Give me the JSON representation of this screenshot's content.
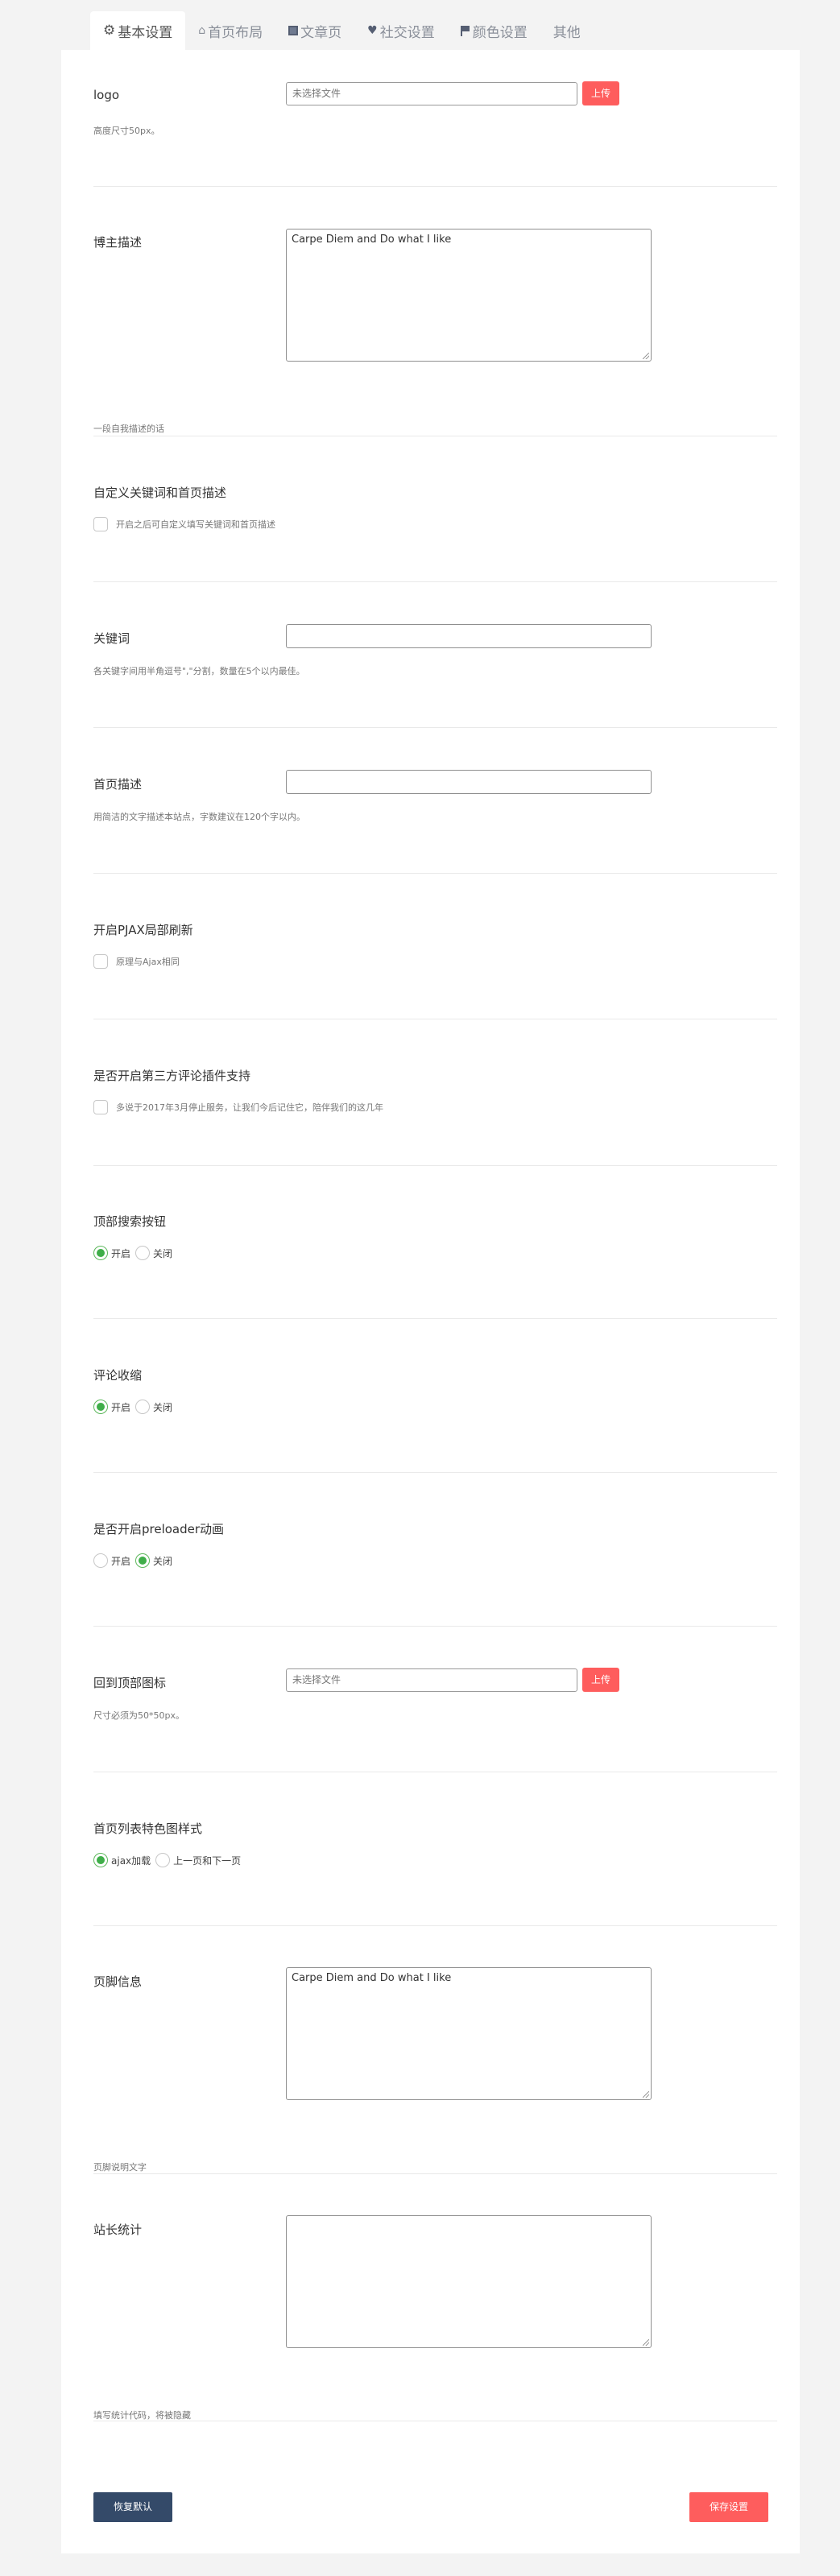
{
  "tabs": [
    {
      "label": "基本设置",
      "icon": "gear-icon"
    },
    {
      "label": "首页布局",
      "icon": "home-icon"
    },
    {
      "label": "文章页",
      "icon": "article-icon"
    },
    {
      "label": "社交设置",
      "icon": "heart-icon"
    },
    {
      "label": "颜色设置",
      "icon": "flag-icon"
    },
    {
      "label": "其他",
      "icon": ""
    }
  ],
  "logo": {
    "label": "logo",
    "file_placeholder": "未选择文件",
    "upload_label": "上传",
    "desc": "高度尺寸50px。"
  },
  "blogger_desc": {
    "label": "博主描述",
    "value": "Carpe Diem and Do what I like",
    "desc": "一段自我描述的话"
  },
  "custom_keywords": {
    "label": "自定义关键词和首页描述",
    "checkbox_label": "开启之后可自定义填写关键词和首页描述",
    "checked": false
  },
  "keywords": {
    "label": "关键词",
    "value": "",
    "desc": "各关键字间用半角逗号\",\"分割，数量在5个以内最佳。"
  },
  "home_desc": {
    "label": "首页描述",
    "value": "",
    "desc": "用简洁的文字描述本站点，字数建议在120个字以内。"
  },
  "pjax": {
    "label": "开启PJAX局部刷新",
    "checkbox_label": "原理与Ajax相同",
    "checked": false
  },
  "third_comment": {
    "label": "是否开启第三方评论插件支持",
    "checkbox_label": "多说于2017年3月停止服务，让我们今后记住它，陪伴我们的这几年",
    "checked": false
  },
  "top_search": {
    "label": "顶部搜索按钮",
    "options": [
      "开启",
      "关闭"
    ],
    "selected": 0
  },
  "comment_collapse": {
    "label": "评论收缩",
    "options": [
      "开启",
      "关闭"
    ],
    "selected": 0
  },
  "preloader": {
    "label": "是否开启preloader动画",
    "options": [
      "开启",
      "关闭"
    ],
    "selected": 1
  },
  "back_top_icon": {
    "label": "回到顶部图标",
    "file_placeholder": "未选择文件",
    "upload_label": "上传",
    "desc": "尺寸必须为50*50px。"
  },
  "list_style": {
    "label": "首页列表特色图样式",
    "options": [
      "ajax加载",
      "上一页和下一页"
    ],
    "selected": 0
  },
  "footer_info": {
    "label": "页脚信息",
    "value": "Carpe Diem and Do what I like",
    "desc": "页脚说明文字"
  },
  "stats": {
    "label": "站长统计",
    "value": "",
    "desc": "填写统计代码，将被隐藏"
  },
  "actions": {
    "restore_label": "恢复默认",
    "save_label": "保存设置"
  },
  "colors": {
    "accent": "#fe5d5d",
    "primary_dark": "#344a69",
    "radio_on": "#3fae49"
  }
}
